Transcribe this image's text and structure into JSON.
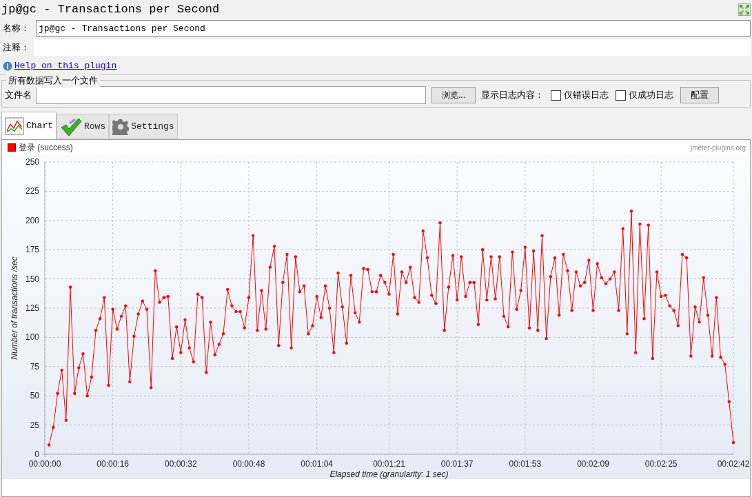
{
  "window": {
    "title": "jp@gc - Transactions per Second"
  },
  "name_field": {
    "label": "名称：",
    "value": "jp@gc - Transactions per Second"
  },
  "comment_field": {
    "label": "注释："
  },
  "help_link": "Help on this plugin",
  "file_group": {
    "title": "所有数据写入一个文件",
    "file_label": "文件名",
    "browse_button": "浏览...",
    "log_label": "显示日志内容：",
    "checkboxes": [
      {
        "label": "仅错误日志",
        "checked": false
      },
      {
        "label": "仅成功日志",
        "checked": false
      }
    ],
    "config_button": "配置"
  },
  "tabs": [
    {
      "label": "Chart",
      "selected": true
    },
    {
      "label": "Rows",
      "selected": false
    },
    {
      "label": "Settings",
      "selected": false
    }
  ],
  "chart": {
    "watermark": "jmeter-plugins.org",
    "chart_data": {
      "type": "line",
      "ylabel": "Number of transactions /sec",
      "xlabel": "Elapsed time (granularity: 1 sec)",
      "x": [
        1,
        2,
        3,
        4,
        5,
        6,
        7,
        8,
        9,
        10,
        11,
        12,
        13,
        14,
        15,
        16,
        17,
        18,
        19,
        20,
        21,
        22,
        23,
        24,
        25,
        26,
        27,
        28,
        29,
        30,
        31,
        32,
        33,
        34,
        35,
        36,
        37,
        38,
        39,
        40,
        41,
        42,
        43,
        44,
        45,
        46,
        47,
        48,
        49,
        50,
        51,
        52,
        53,
        54,
        55,
        56,
        57,
        58,
        59,
        60,
        61,
        62,
        63,
        64,
        65,
        66,
        67,
        68,
        69,
        70,
        71,
        72,
        73,
        74,
        75,
        76,
        77,
        78,
        79,
        80,
        81,
        82,
        83,
        84,
        85,
        86,
        87,
        88,
        89,
        90,
        91,
        92,
        93,
        94,
        95,
        96,
        97,
        98,
        99,
        100,
        101,
        102,
        103,
        104,
        105,
        106,
        107,
        108,
        109,
        110,
        111,
        112,
        113,
        114,
        115,
        116,
        117,
        118,
        119,
        120,
        121,
        122,
        123,
        124,
        125,
        126,
        127,
        128,
        129,
        130,
        131,
        132,
        133,
        134,
        135,
        136,
        137,
        138,
        139,
        140,
        141,
        142,
        143,
        144,
        145,
        146,
        147,
        148,
        149,
        150,
        151,
        152,
        153,
        154,
        155,
        156,
        157,
        158,
        159,
        160,
        161,
        162
      ],
      "series": [
        {
          "name": "登录 (success)",
          "color": "#ff0000",
          "values": [
            8,
            23,
            52,
            72,
            29,
            143,
            52,
            74,
            86,
            50,
            66,
            106,
            116,
            134,
            59,
            124,
            107,
            118,
            127,
            62,
            101,
            120,
            131,
            124,
            57,
            157,
            130,
            134,
            135,
            82,
            109,
            87,
            115,
            91,
            79,
            137,
            134,
            70,
            113,
            85,
            94,
            103,
            141,
            127,
            122,
            122,
            108,
            134,
            187,
            106,
            140,
            107,
            160,
            178,
            93,
            147,
            171,
            91,
            169,
            139,
            144,
            103,
            110,
            135,
            117,
            144,
            125,
            87,
            155,
            126,
            95,
            153,
            121,
            113,
            159,
            158,
            139,
            139,
            153,
            147,
            137,
            171,
            120,
            156,
            147,
            160,
            134,
            130,
            191,
            168,
            136,
            129,
            198,
            106,
            143,
            170,
            132,
            169,
            135,
            147,
            147,
            111,
            175,
            132,
            169,
            133,
            169,
            118,
            109,
            173,
            124,
            140,
            177,
            108,
            174,
            106,
            187,
            99,
            152,
            168,
            119,
            171,
            157,
            123,
            156,
            144,
            147,
            166,
            123,
            163,
            151,
            146,
            150,
            156,
            123,
            193,
            103,
            208,
            87,
            197,
            116,
            196,
            82,
            156,
            135,
            136,
            127,
            123,
            110,
            171,
            168,
            84,
            126,
            113,
            151,
            119,
            84,
            134,
            83,
            77,
            45,
            10
          ]
        }
      ],
      "xlim": [
        0,
        162
      ],
      "ylim": [
        0,
        250
      ],
      "grid": true,
      "xticks": [
        {
          "value": 0,
          "label": "00:00:00"
        },
        {
          "value": 16,
          "label": "00:00:16"
        },
        {
          "value": 32,
          "label": "00:00:32"
        },
        {
          "value": 48,
          "label": "00:00:48"
        },
        {
          "value": 64,
          "label": "00:01:04"
        },
        {
          "value": 81,
          "label": "00:01:21"
        },
        {
          "value": 97,
          "label": "00:01:37"
        },
        {
          "value": 113,
          "label": "00:01:53"
        },
        {
          "value": 129,
          "label": "00:02:09"
        },
        {
          "value": 145,
          "label": "00:02:25"
        },
        {
          "value": 162,
          "label": "00:02:42"
        }
      ],
      "yticks": [
        0,
        25,
        50,
        75,
        100,
        125,
        150,
        175,
        200,
        225,
        250
      ]
    }
  }
}
